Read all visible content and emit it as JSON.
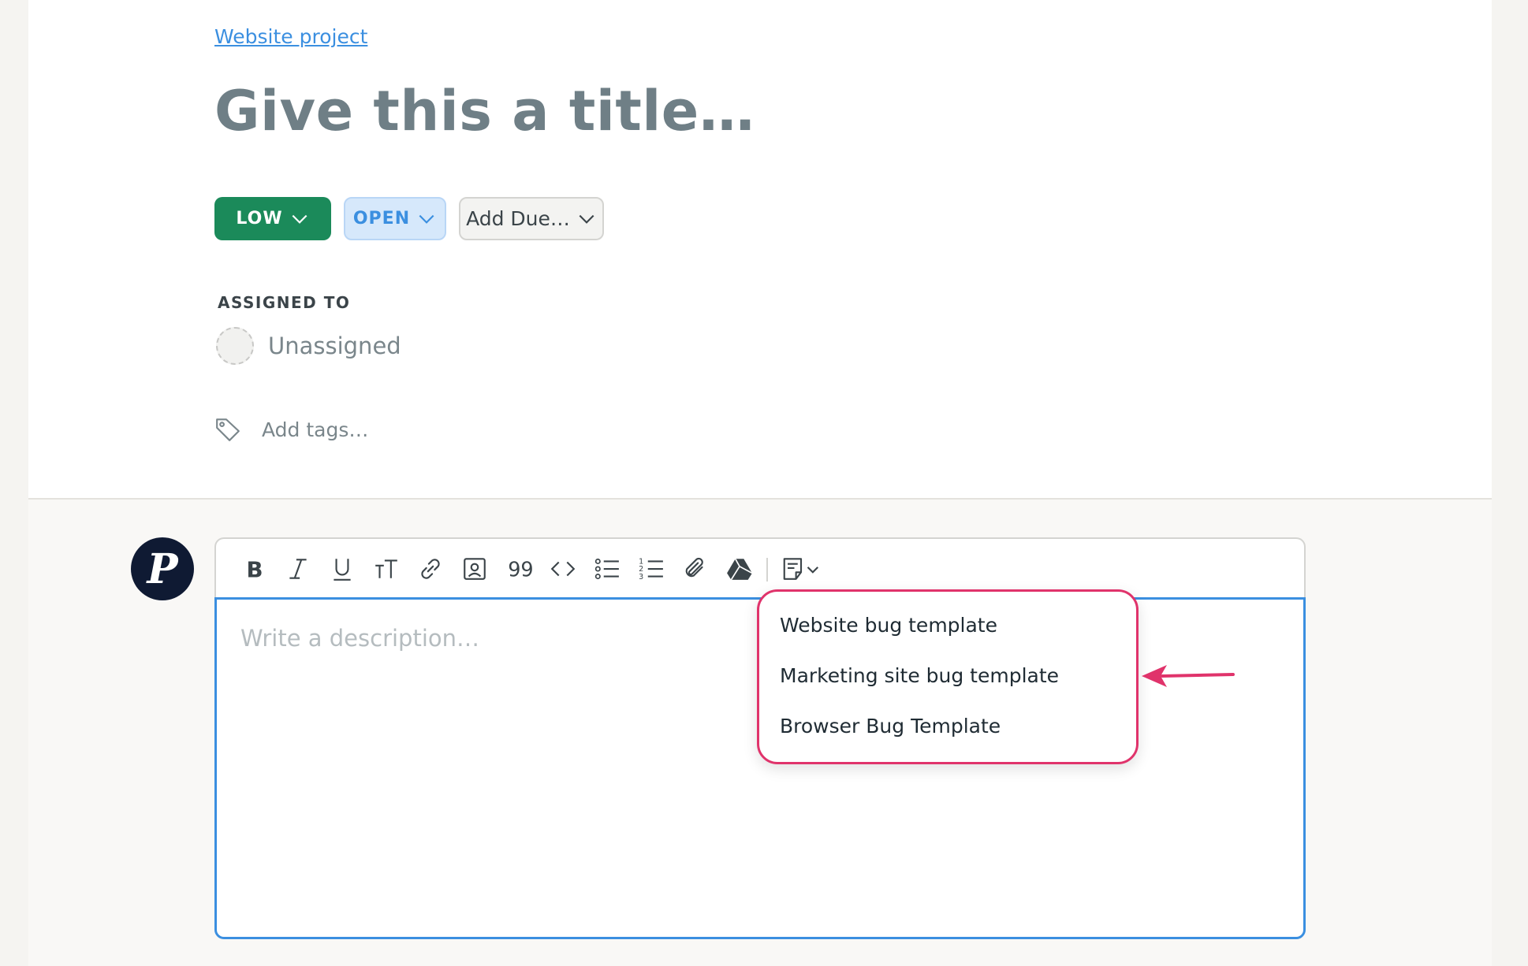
{
  "breadcrumb": {
    "label": "Website project"
  },
  "task": {
    "title_placeholder": "Give this a title…"
  },
  "status_pills": {
    "priority": "LOW",
    "status": "OPEN",
    "due": "Add Due…"
  },
  "assignment": {
    "label": "ASSIGNED TO",
    "value": "Unassigned"
  },
  "tags": {
    "placeholder": "Add tags…"
  },
  "editor": {
    "placeholder": "Write a description…",
    "toolbar_icons": [
      "bold-icon",
      "italic-icon",
      "underline-icon",
      "text-size-icon",
      "link-icon",
      "image-icon",
      "quote-icon",
      "code-icon",
      "bullet-list-icon",
      "numbered-list-icon",
      "attachment-icon",
      "google-drive-icon",
      "template-icon"
    ]
  },
  "template_menu": {
    "items": [
      {
        "label": "Website bug template"
      },
      {
        "label": "Marketing site bug template"
      },
      {
        "label": "Browser Bug Template"
      }
    ]
  },
  "colors": {
    "priority_low": "#1b8a5a",
    "status_open_bg": "#d6e8fb",
    "link": "#3b8fe0",
    "highlight": "#e0336b",
    "editor_focus": "#3b8fe0"
  }
}
